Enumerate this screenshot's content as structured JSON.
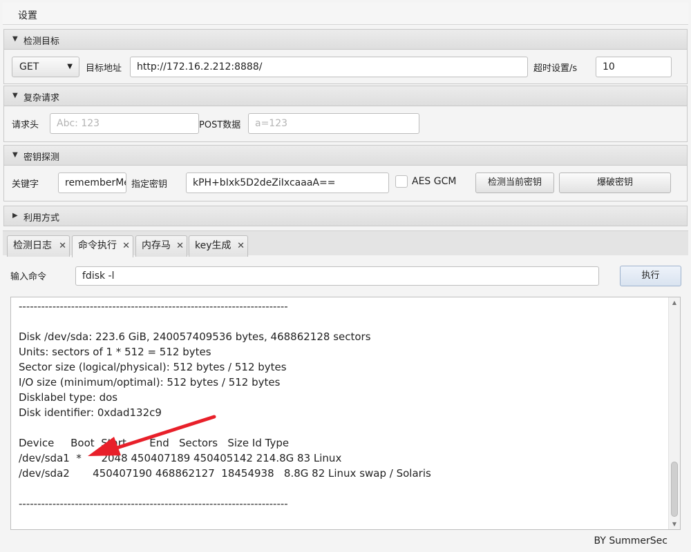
{
  "menubar": {
    "settings": "设置"
  },
  "detect_target": {
    "title": "检测目标",
    "method": "GET",
    "target_label": "目标地址",
    "target_value": "http://172.16.2.212:8888/",
    "timeout_label": "超时设置/s",
    "timeout_value": "10"
  },
  "complex_request": {
    "title": "复杂请求",
    "header_label": "请求头",
    "header_placeholder": "Abc: 123",
    "post_label": "POST数据",
    "post_placeholder": "a=123"
  },
  "key_probe": {
    "title": "密钥探测",
    "keyword_label": "关键字",
    "keyword_value": "rememberMe",
    "key_label": "指定密钥",
    "key_value": "kPH+bIxk5D2deZiIxcaaaA==",
    "aes_gcm_label": "AES GCM",
    "aes_gcm_checked": false,
    "detect_key_button": "检测当前密钥",
    "brute_key_button": "爆破密钥"
  },
  "exploit": {
    "title": "利用方式"
  },
  "tabs": [
    {
      "label": "检测日志",
      "close": "✕"
    },
    {
      "label": "命令执行",
      "close": "✕"
    },
    {
      "label": "内存马",
      "close": "✕"
    },
    {
      "label": "key生成",
      "close": "✕"
    }
  ],
  "active_tab": 1,
  "command": {
    "label": "输入命令",
    "value": "fdisk -l",
    "execute_button": "执行"
  },
  "console_output": "------------------------------------------------------------------------\n\nDisk /dev/sda: 223.6 GiB, 240057409536 bytes, 468862128 sectors\nUnits: sectors of 1 * 512 = 512 bytes\nSector size (logical/physical): 512 bytes / 512 bytes\nI/O size (minimum/optimal): 512 bytes / 512 bytes\nDisklabel type: dos\nDisk identifier: 0xdad132c9\n\nDevice     Boot  Start       End   Sectors   Size Id Type\n/dev/sda1  *      2048 450407189 450405142 214.8G 83 Linux\n/dev/sda2       450407190 468862127  18454938   8.8G 82 Linux swap / Solaris\n\n------------------------------------------------------------------------",
  "icons": {
    "collapse_expanded": "▼",
    "collapse_collapsed": "▶",
    "dropdown": "▼",
    "scroll_up": "▲",
    "scroll_down": "▼"
  },
  "colors": {
    "annotation_arrow": "#e8202a"
  },
  "footer": "BY   SummerSec"
}
